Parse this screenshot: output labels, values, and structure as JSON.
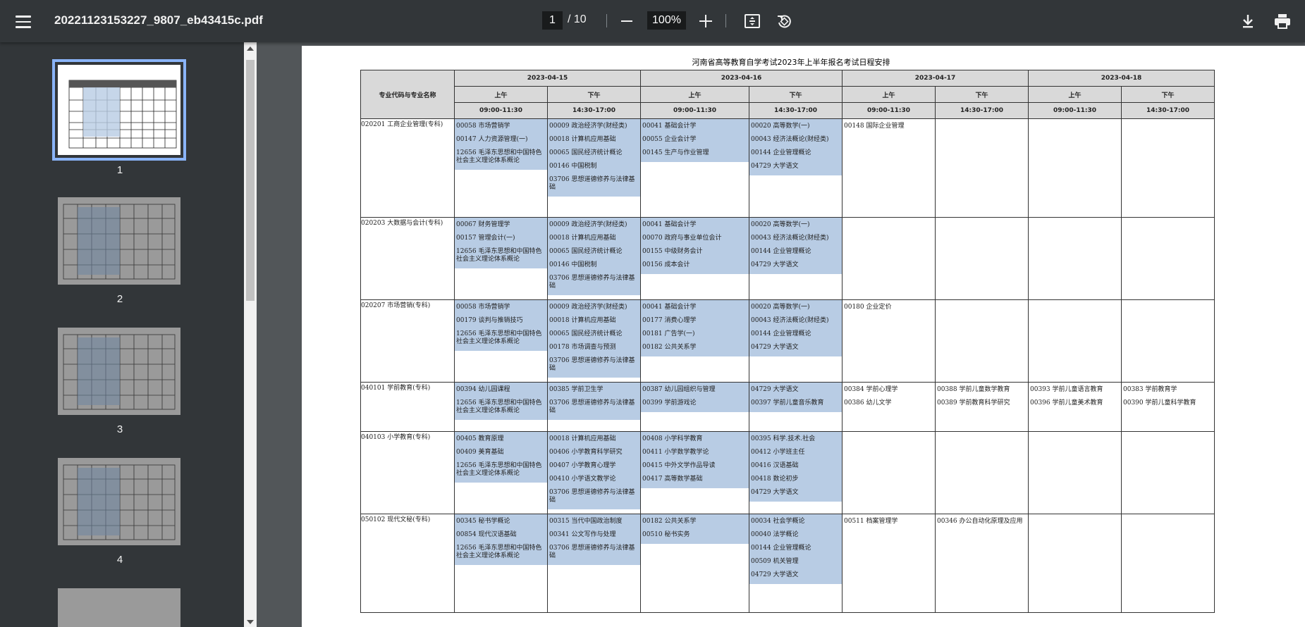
{
  "toolbar": {
    "filename": "20221123153227_9807_eb43415c.pdf",
    "current_page": "1",
    "total_pages": "/ 10",
    "zoom": "100%"
  },
  "sidebar": {
    "thumbnails": [
      {
        "label": "1",
        "selected": true
      },
      {
        "label": "2",
        "selected": false
      },
      {
        "label": "3",
        "selected": false
      },
      {
        "label": "4",
        "selected": false
      }
    ]
  },
  "document": {
    "title": "河南省高等教育自学考试2023年上半年报名考试日程安排",
    "major_header": "专业代码与专业名称",
    "dates": [
      "2023-04-15",
      "2023-04-16",
      "2023-04-17",
      "2023-04-18"
    ],
    "halves": [
      "上午",
      "下午",
      "上午",
      "下午",
      "上午",
      "下午",
      "上午",
      "下午"
    ],
    "times": [
      "09:00-11:30",
      "14:30-17:00",
      "09:00-11:30",
      "14:30-17:00",
      "09:00-11:30",
      "14:30-17:00",
      "09:00-11:30",
      "14:30-17:00"
    ],
    "rows": [
      {
        "major": "020201 工商企业管理(专科)",
        "cells": [
          [
            "00058 市场营销学",
            "00147 人力资源管理(一)",
            "12656 毛泽东思想和中国特色社会主义理论体系概论"
          ],
          [
            "00009 政治经济学(财经类)",
            "00018 计算机应用基础",
            "00065 国民经济统计概论",
            "00146 中国税制",
            "03706 思想道德修养与法律基础"
          ],
          [
            "00041 基础会计学",
            "00055 企业会计学",
            "00145 生产与作业管理"
          ],
          [
            "00020 高等数学(一)",
            "00043 经济法概论(财经类)",
            "00144 企业管理概论",
            "04729 大学语文"
          ],
          [
            "00148 国际企业管理"
          ],
          [],
          [],
          []
        ]
      },
      {
        "major": "020203 大数据与会计(专科)",
        "cells": [
          [
            "00067 财务管理学",
            "00157 管理会计(一)",
            "12656 毛泽东思想和中国特色社会主义理论体系概论"
          ],
          [
            "00009 政治经济学(财经类)",
            "00018 计算机应用基础",
            "00065 国民经济统计概论",
            "00146 中国税制",
            "03706 思想道德修养与法律基础"
          ],
          [
            "00041 基础会计学",
            "00070 政府与事业单位会计",
            "00155 中级财务会计",
            "00156 成本会计"
          ],
          [
            "00020 高等数学(一)",
            "00043 经济法概论(财经类)",
            "00144 企业管理概论",
            "04729 大学语文"
          ],
          [],
          [],
          [],
          []
        ]
      },
      {
        "major": "020207 市场营销(专科)",
        "cells": [
          [
            "00058 市场营销学",
            "00179 谈判与推销技巧",
            "12656 毛泽东思想和中国特色社会主义理论体系概论"
          ],
          [
            "00009 政治经济学(财经类)",
            "00018 计算机应用基础",
            "00065 国民经济统计概论",
            "00178 市场调查与预测",
            "03706 思想道德修养与法律基础"
          ],
          [
            "00041 基础会计学",
            "00177 消费心理学",
            "00181 广告学(一)",
            "00182 公共关系学"
          ],
          [
            "00020 高等数学(一)",
            "00043 经济法概论(财经类)",
            "00144 企业管理概论",
            "04729 大学语文"
          ],
          [
            "00180 企业定价"
          ],
          [],
          [],
          []
        ]
      },
      {
        "major": "040101 学前教育(专科)",
        "cells": [
          [
            "00394 幼儿园课程",
            "12656 毛泽东思想和中国特色社会主义理论体系概论"
          ],
          [
            "00385 学前卫生学",
            "03706 思想道德修养与法律基础"
          ],
          [
            "00387 幼儿园组织与管理",
            "00399 学前游戏论"
          ],
          [
            "04729 大学语文",
            "00397 学前儿童音乐教育"
          ],
          [
            "00384 学前心理学",
            "00386 幼儿文学"
          ],
          [
            "00388 学前儿童数学教育",
            "00389 学前教育科学研究"
          ],
          [
            "00393 学前儿童语言教育",
            "00396 学前儿童美术教育"
          ],
          [
            "00383 学前教育学",
            "00390 学前儿童科学教育"
          ]
        ]
      },
      {
        "major": "040103 小学教育(专科)",
        "cells": [
          [
            "00405 教育原理",
            "00409 美育基础",
            "12656 毛泽东思想和中国特色社会主义理论体系概论"
          ],
          [
            "00018 计算机应用基础",
            "00406 小学教育科学研究",
            "00407 小学教育心理学",
            "00410 小学语文教学论",
            "03706 思想道德修养与法律基础"
          ],
          [
            "00408 小学科学教育",
            "00411 小学数学教学论",
            "00415 中外文学作品导读",
            "00417 高等数学基础"
          ],
          [
            "00395 科学.技术.社会",
            "00412 小学班主任",
            "00416 汉语基础",
            "00418 数论初步",
            "04729 大学语文"
          ],
          [],
          [],
          [],
          []
        ]
      },
      {
        "major": "050102 现代文秘(专科)",
        "cells": [
          [
            "00345 秘书学概论",
            "00854 现代汉语基础",
            "12656 毛泽东思想和中国特色社会主义理论体系概论"
          ],
          [
            "00315 当代中国政治制度",
            "00341 公文写作与处理",
            "03706 思想道德修养与法律基础"
          ],
          [
            "00182 公共关系学",
            "00510 秘书实务"
          ],
          [
            "00034 社会学概论",
            "00040 法学概论",
            "00144 企业管理概论",
            "00509 机关管理",
            "04729 大学语文"
          ],
          [
            "00511 档案管理学"
          ],
          [
            "00346 办公自动化原理及应用"
          ],
          [],
          []
        ]
      }
    ]
  }
}
